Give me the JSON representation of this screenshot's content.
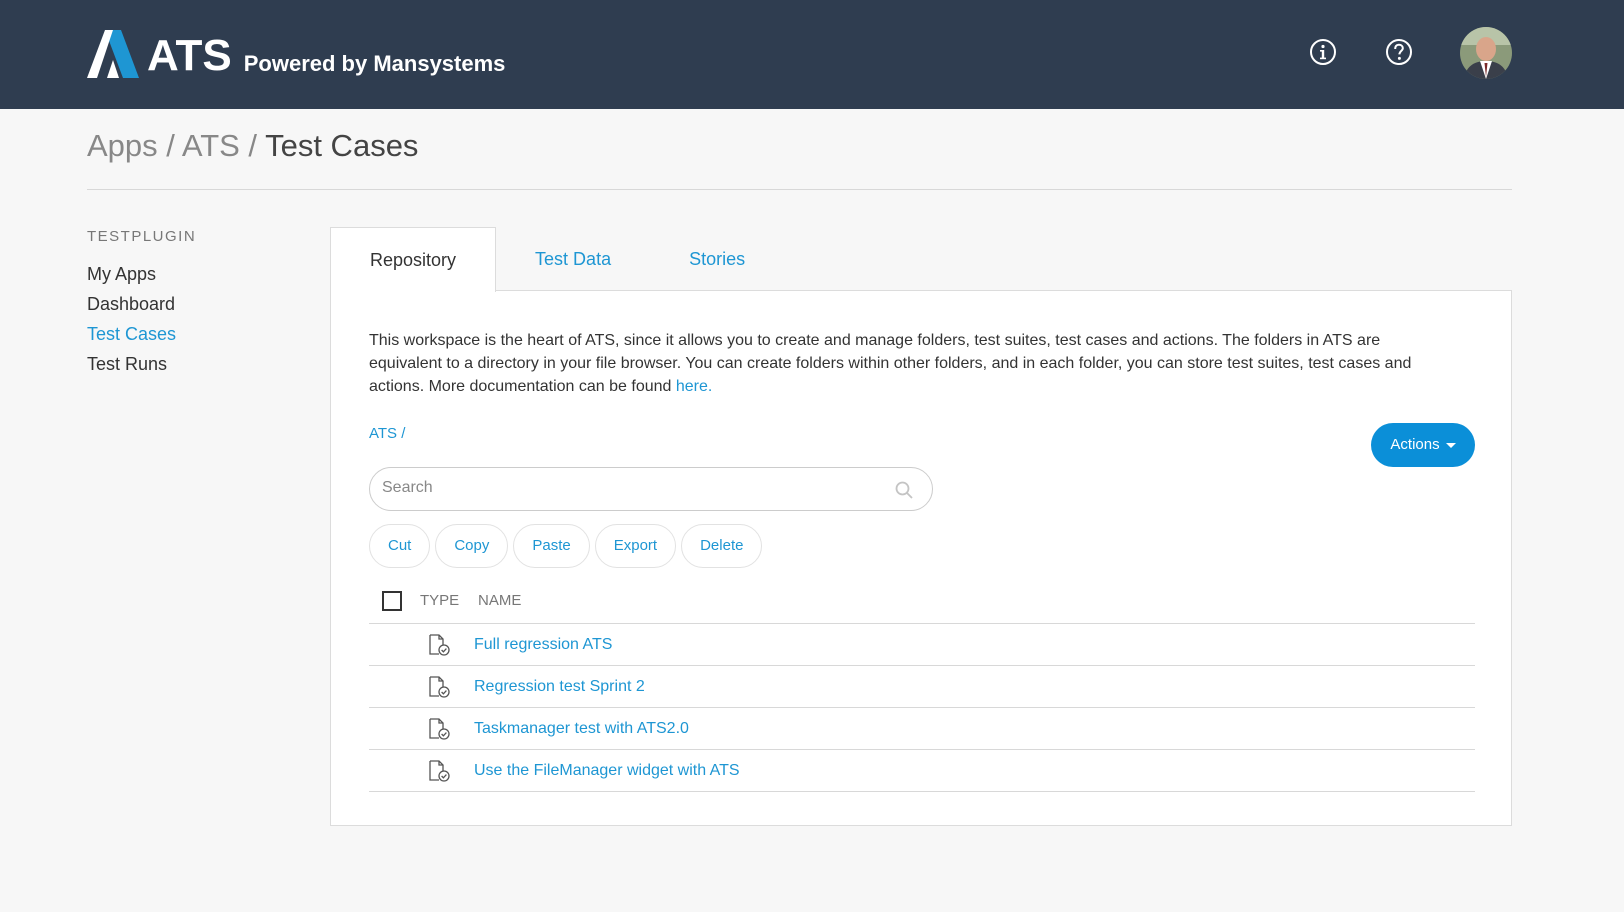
{
  "header": {
    "logo_text": "ATS",
    "logo_sub": "Powered by Mansystems",
    "info_icon": "info-icon",
    "help_icon": "help-icon",
    "avatar": "user-avatar"
  },
  "breadcrumb": {
    "part1": "Apps",
    "sep1": " / ",
    "part2": "ATS",
    "sep2": " / ",
    "current": "Test Cases"
  },
  "sidebar": {
    "heading": "TESTPLUGIN",
    "items": [
      {
        "label": "My Apps"
      },
      {
        "label": "Dashboard"
      },
      {
        "label": "Test Cases"
      },
      {
        "label": "Test Runs"
      }
    ]
  },
  "tabs": [
    {
      "label": "Repository"
    },
    {
      "label": "Test Data"
    },
    {
      "label": "Stories"
    }
  ],
  "repository": {
    "description": "This workspace is the heart of ATS, since it allows you to create and manage folders, test suites, test cases and actions. The folders in ATS are equivalent to a directory in your file browser. You can create folders within other folders, and in each folder, you can store test suites, test cases and actions. More documentation can be found ",
    "doc_link": "here.",
    "path": "ATS /",
    "actions_label": "Actions",
    "search_placeholder": "Search",
    "buttons": {
      "cut": "Cut",
      "copy": "Copy",
      "paste": "Paste",
      "export": "Export",
      "delete": "Delete"
    },
    "columns": {
      "type": "TYPE",
      "name": "NAME"
    },
    "rows": [
      {
        "name": "Full regression ATS"
      },
      {
        "name": "Regression test Sprint 2"
      },
      {
        "name": "Taskmanager test with ATS2.0"
      },
      {
        "name": "Use the FileManager widget with ATS"
      }
    ]
  },
  "colors": {
    "topbar": "#2f3d50",
    "accent": "#1e96d3",
    "primary_button": "#0b8fd8"
  }
}
